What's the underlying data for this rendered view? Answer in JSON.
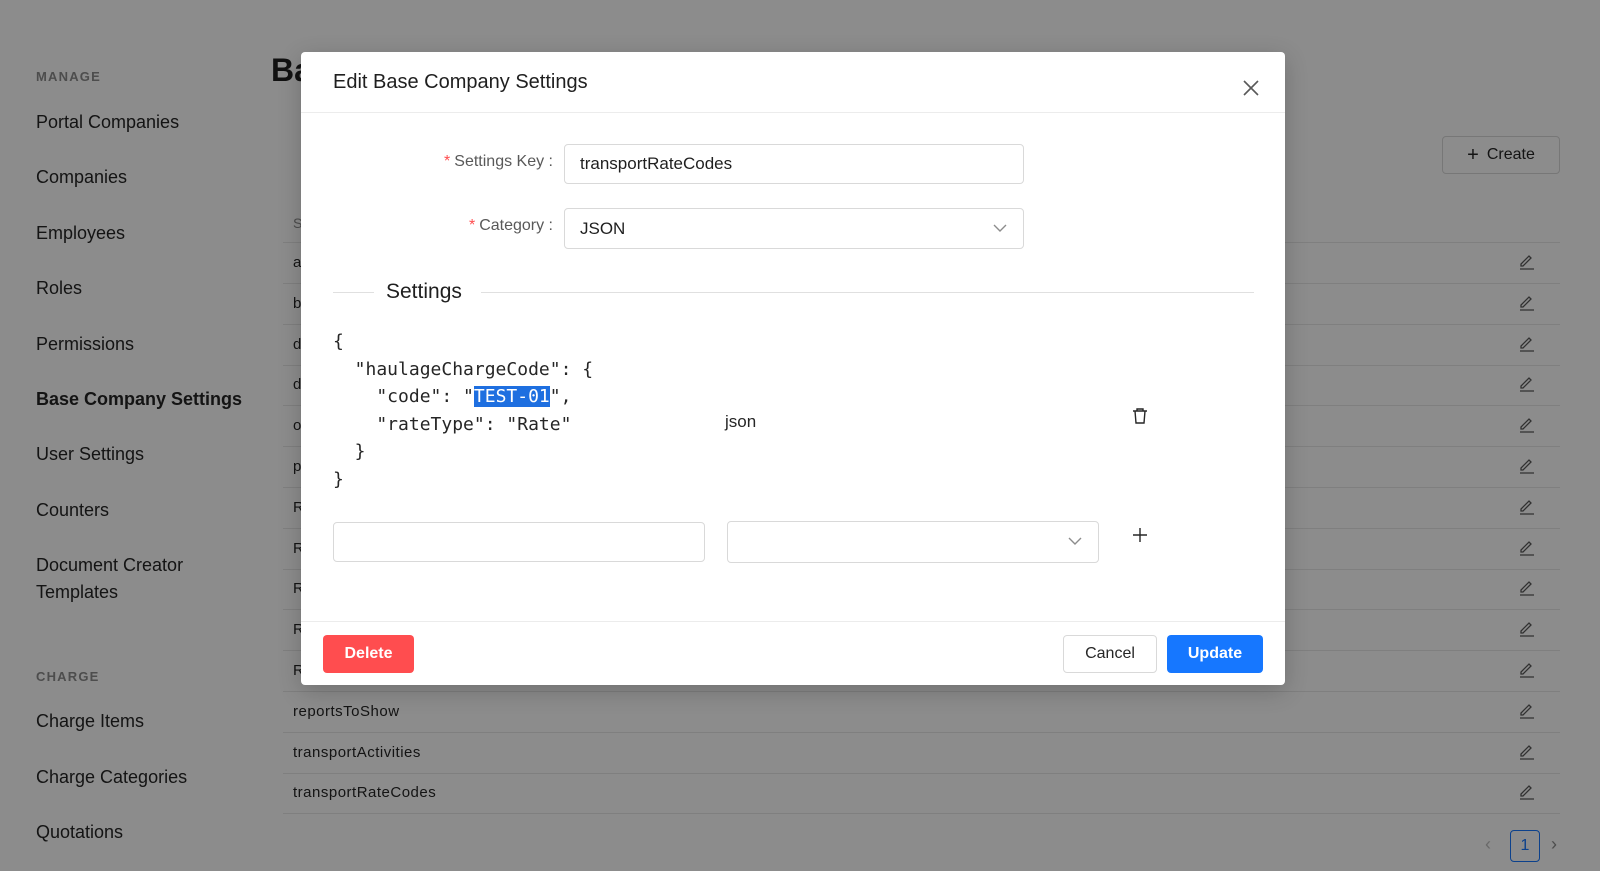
{
  "sidebar": {
    "manage_title": "MANAGE",
    "manage_items": [
      {
        "label": "Portal Companies"
      },
      {
        "label": "Companies"
      },
      {
        "label": "Employees"
      },
      {
        "label": "Roles"
      },
      {
        "label": "Permissions"
      },
      {
        "label": "Base Company Settings",
        "active": true
      },
      {
        "label": "User Settings"
      },
      {
        "label": "Counters"
      },
      {
        "label": "Document Creator"
      },
      {
        "label": "Templates"
      }
    ],
    "charge_title": "CHARGE",
    "charge_items": [
      {
        "label": "Charge Items"
      },
      {
        "label": "Charge Categories"
      },
      {
        "label": "Quotations"
      }
    ]
  },
  "main": {
    "title_partial": "Ba",
    "create_label": "Create",
    "table_header_partial": "S",
    "rows": [
      "a",
      "b",
      "d",
      "d",
      "o",
      "p",
      "R",
      "R",
      "R",
      "R",
      "R",
      "reportsToShow",
      "transportActivities",
      "transportRateCodes"
    ],
    "pagination": {
      "current": "1",
      "prev": "‹",
      "next": "›"
    }
  },
  "modal": {
    "title": "Edit Base Company Settings",
    "settings_key_label": "Settings Key",
    "settings_key_value": "transportRateCodes",
    "category_label": "Category",
    "category_value": "JSON",
    "section_title": "Settings",
    "json_lines": {
      "l1": "{",
      "l2": "  \"haulageChargeCode\": {",
      "l3_pre": "    \"code\": \"",
      "l3_sel": "TEST-01",
      "l3_post": "\",",
      "l4": "    \"rateType\": \"Rate\"",
      "l5": "  }",
      "l6": "}"
    },
    "entry_type": "json",
    "new_key_value": "",
    "new_type_value": "",
    "delete_label": "Delete",
    "cancel_label": "Cancel",
    "update_label": "Update"
  },
  "colors": {
    "primary": "#1677ff",
    "danger": "#ff4d4f",
    "selection": "#1e6fe0"
  }
}
